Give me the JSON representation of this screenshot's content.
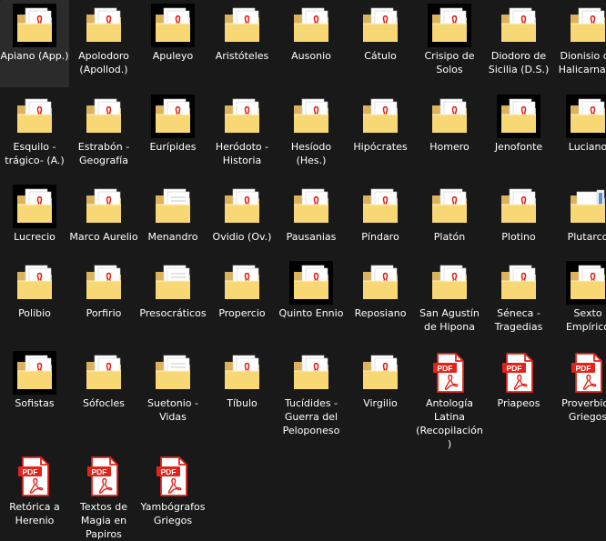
{
  "window": {
    "view": "Large icons"
  },
  "colors": {
    "background": "#191919",
    "text": "#ffffff",
    "folder_back": "#dcb35c",
    "folder_front": "#f8d775",
    "pdf_red": "#e0241b",
    "thumb_bg": "#000000"
  },
  "items": [
    {
      "name": "Apiano (App.)",
      "icon": "folder-pdf-black-icon"
    },
    {
      "name": "Apolodoro (Apollod.)",
      "icon": "folder-pdf-icon"
    },
    {
      "name": "Apuleyo",
      "icon": "folder-pdf-black-icon"
    },
    {
      "name": "Aristóteles",
      "icon": "folder-pdf-icon"
    },
    {
      "name": "Ausonio",
      "icon": "folder-pdf-icon"
    },
    {
      "name": "Cátulo",
      "icon": "folder-pdf-icon"
    },
    {
      "name": "Crisipo de Solos",
      "icon": "folder-pdf-black-icon"
    },
    {
      "name": "Diodoro de Sicilia (D.S.)",
      "icon": "folder-pdf-icon"
    },
    {
      "name": "Dionisio de Halicarnaso",
      "icon": "folder-pdf-icon"
    },
    {
      "name": "Esquilo -trágico- (A.)",
      "icon": "folder-pdf-icon"
    },
    {
      "name": "Estrabón - Geografía",
      "icon": "folder-pdf-icon"
    },
    {
      "name": "Eurípides",
      "icon": "folder-pdf-black-icon"
    },
    {
      "name": "Heródoto - Historia",
      "icon": "folder-pdf-icon"
    },
    {
      "name": "Hesíodo (Hes.)",
      "icon": "folder-pdf-icon"
    },
    {
      "name": "Hipócrates",
      "icon": "folder-pdf-icon"
    },
    {
      "name": "Homero",
      "icon": "folder-pdf-icon"
    },
    {
      "name": "Jenofonte",
      "icon": "folder-pdf-black-icon"
    },
    {
      "name": "Luciano",
      "icon": "folder-pdf-black-icon"
    },
    {
      "name": "Lucrecio",
      "icon": "folder-pdf-black-icon"
    },
    {
      "name": "Marco Aurelio",
      "icon": "folder-pdf-icon"
    },
    {
      "name": "Menandro",
      "icon": "folder-plain-icon"
    },
    {
      "name": "Ovidio (Ov.)",
      "icon": "folder-pdf-icon"
    },
    {
      "name": "Pausanias",
      "icon": "folder-pdf-icon"
    },
    {
      "name": "Píndaro",
      "icon": "folder-pdf-icon"
    },
    {
      "name": "Platón",
      "icon": "folder-pdf-icon"
    },
    {
      "name": "Plotino",
      "icon": "folder-pdf-icon"
    },
    {
      "name": "Plutarco",
      "icon": "folder-docs-icon"
    },
    {
      "name": "Polibio",
      "icon": "folder-pdf-icon"
    },
    {
      "name": "Porfirio",
      "icon": "folder-pdf-icon"
    },
    {
      "name": "Presocráticos",
      "icon": "folder-plain-icon"
    },
    {
      "name": "Propercio",
      "icon": "folder-pdf-icon"
    },
    {
      "name": "Quinto Ennio",
      "icon": "folder-pdf-black-icon"
    },
    {
      "name": "Reposiano",
      "icon": "folder-pdf-icon"
    },
    {
      "name": "San Agustín de Hipona",
      "icon": "folder-pdf-icon"
    },
    {
      "name": "Séneca - Tragedias",
      "icon": "folder-pdf-icon"
    },
    {
      "name": "Sexto Empírico",
      "icon": "folder-pdf-black-icon"
    },
    {
      "name": "Sofistas",
      "icon": "folder-pdf-black-icon"
    },
    {
      "name": "Sófocles",
      "icon": "folder-pdf-icon"
    },
    {
      "name": "Suetonio - Vidas",
      "icon": "folder-plain-icon"
    },
    {
      "name": "Tíbulo",
      "icon": "folder-pdf-icon"
    },
    {
      "name": "Tucídides - Guerra del Peloponeso",
      "icon": "folder-pdf-icon"
    },
    {
      "name": "Virgilio",
      "icon": "folder-pdf-icon"
    },
    {
      "name": "Antología Latina (Recopilación)",
      "icon": "pdf-file-icon"
    },
    {
      "name": "Priapeos",
      "icon": "pdf-file-icon"
    },
    {
      "name": "Proverbios Griegos",
      "icon": "pdf-file-icon"
    },
    {
      "name": "Retórica a Herenio",
      "icon": "pdf-file-icon"
    },
    {
      "name": "Textos de Magia en Papiros",
      "icon": "pdf-file-icon"
    },
    {
      "name": "Yambógrafos Griegos",
      "icon": "pdf-file-icon"
    }
  ],
  "pdf_badge_text": "PDF"
}
